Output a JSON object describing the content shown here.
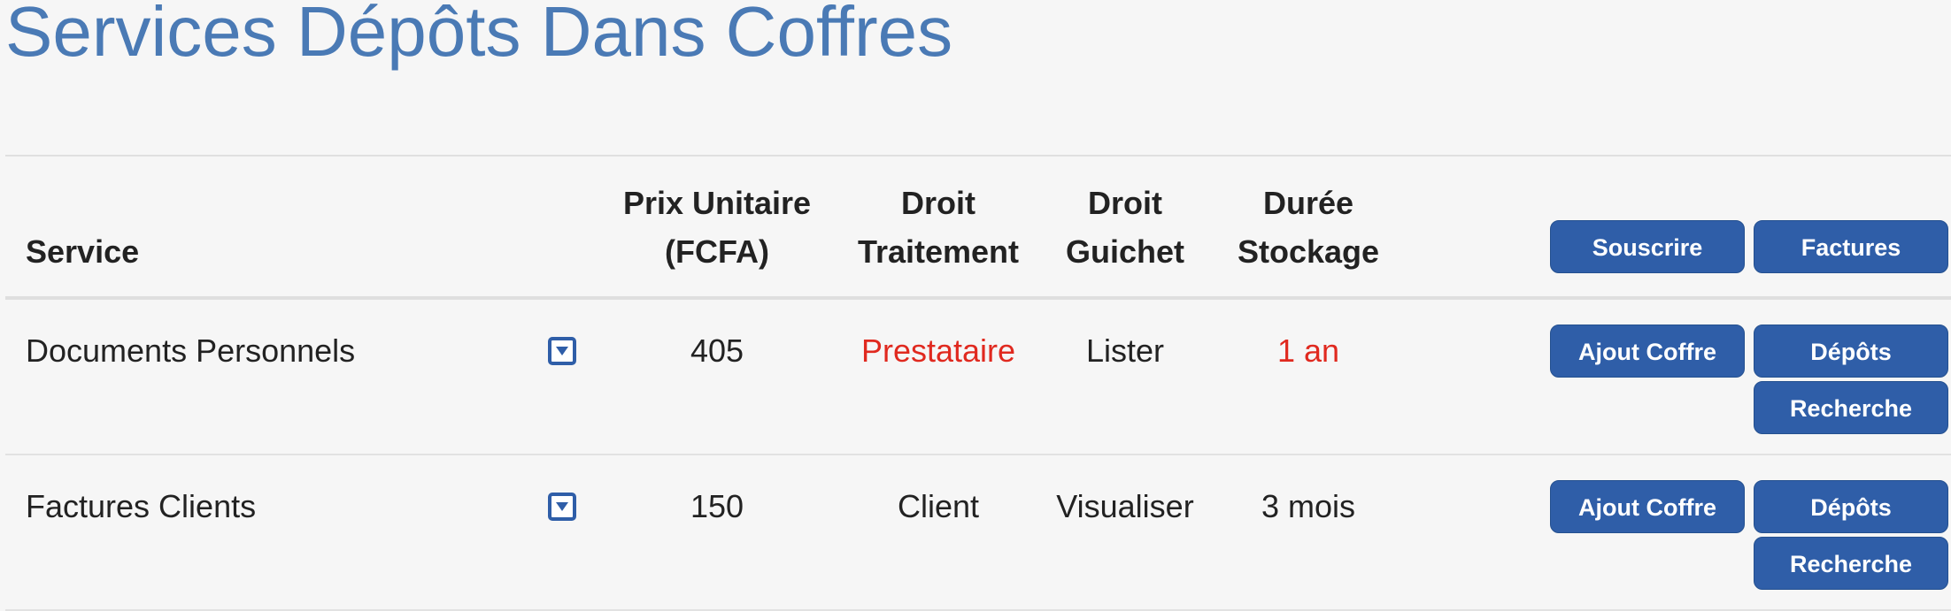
{
  "page": {
    "title": "Services Dépôts Dans Coffres"
  },
  "table": {
    "headers": {
      "service": "Service",
      "prix_line1": "Prix Unitaire",
      "prix_line2": "(FCFA)",
      "traitement_line1": "Droit",
      "traitement_line2": "Traitement",
      "guichet_line1": "Droit",
      "guichet_line2": "Guichet",
      "duree_line1": "Durée",
      "duree_line2": "Stockage"
    },
    "header_actions": {
      "subscribe_label": "Souscrire",
      "invoices_label": "Factures"
    },
    "rows": [
      {
        "service": "Documents Personnels",
        "prix": "405",
        "droit_traitement": "Prestataire",
        "droit_guichet": "Lister",
        "duree": "1 an",
        "add_safe_label": "Ajout Coffre",
        "deposits_label": "Dépôts",
        "search_label": "Recherche"
      },
      {
        "service": "Factures Clients",
        "prix": "150",
        "droit_traitement": "Client",
        "droit_guichet": "Visualiser",
        "duree": "3 mois",
        "add_safe_label": "Ajout Coffre",
        "deposits_label": "Dépôts",
        "search_label": "Recherche"
      }
    ]
  },
  "icons": {
    "row_dropdown": "chevron-down-square-icon"
  },
  "colors": {
    "title": "#4a7ab5",
    "button": "#2f5ea8",
    "highlight_text": "#e0291f",
    "background": "#f6f6f6"
  }
}
